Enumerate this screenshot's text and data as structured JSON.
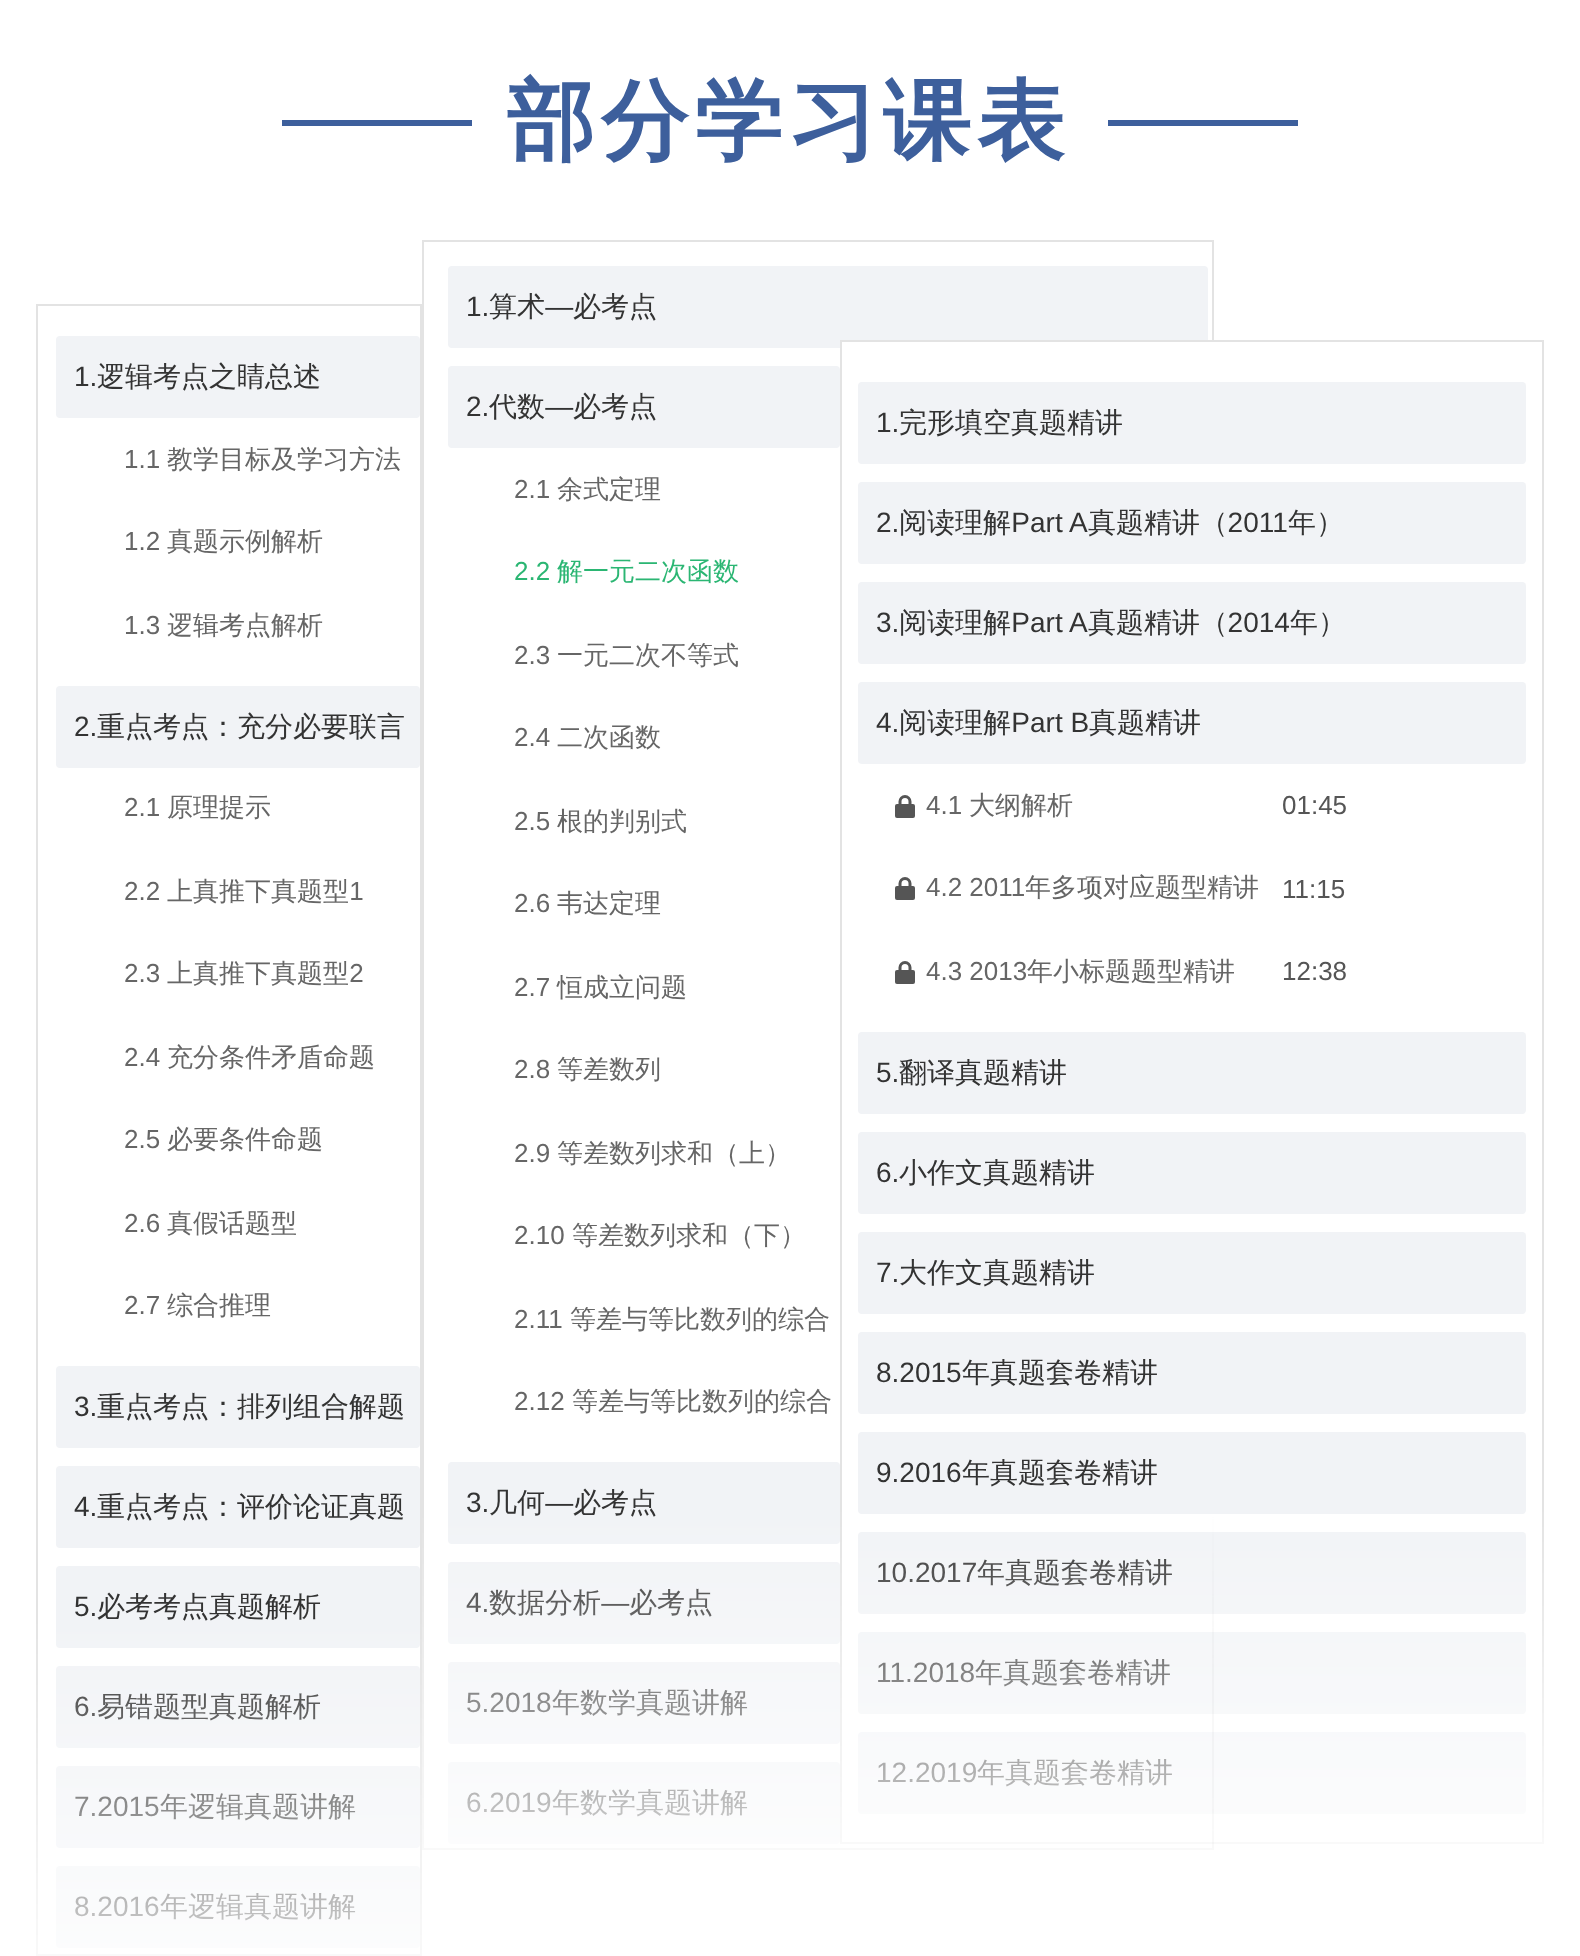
{
  "title": "部分学习课表",
  "cards": [
    {
      "sections": [
        {
          "title": "1.逻辑考点之睛总述",
          "lessons": [
            {
              "title": "1.1 教学目标及学习方法",
              "selected": false
            },
            {
              "title": "1.2 真题示例解析",
              "selected": false
            },
            {
              "title": "1.3 逻辑考点解析",
              "selected": false
            }
          ]
        },
        {
          "title": "2.重点考点：充分必要联言",
          "lessons": [
            {
              "title": "2.1 原理提示",
              "selected": false
            },
            {
              "title": "2.2 上真推下真题型1",
              "selected": false
            },
            {
              "title": "2.3 上真推下真题型2",
              "selected": false
            },
            {
              "title": "2.4 充分条件矛盾命题",
              "selected": false
            },
            {
              "title": "2.5 必要条件命题",
              "selected": false
            },
            {
              "title": "2.6 真假话题型",
              "selected": false
            },
            {
              "title": "2.7 综合推理",
              "selected": false
            }
          ]
        },
        {
          "title": "3.重点考点：排列组合解题"
        },
        {
          "title": "4.重点考点：评价论证真题"
        },
        {
          "title": "5.必考考点真题解析"
        },
        {
          "title": "6.易错题型真题解析"
        },
        {
          "title": "7.2015年逻辑真题讲解"
        },
        {
          "title": "8.2016年逻辑真题讲解"
        }
      ]
    },
    {
      "sections": [
        {
          "title": "1.算术—必考点"
        },
        {
          "title": "2.代数—必考点",
          "lessons": [
            {
              "title": "2.1 余式定理",
              "selected": false
            },
            {
              "title": "2.2 解一元二次函数",
              "selected": true
            },
            {
              "title": "2.3 一元二次不等式",
              "selected": false
            },
            {
              "title": "2.4 二次函数",
              "selected": false
            },
            {
              "title": "2.5 根的判别式",
              "selected": false
            },
            {
              "title": "2.6 韦达定理",
              "selected": false
            },
            {
              "title": "2.7 恒成立问题",
              "selected": false
            },
            {
              "title": "2.8 等差数列",
              "selected": false
            },
            {
              "title": "2.9 等差数列求和（上）",
              "selected": false
            },
            {
              "title": "2.10 等差数列求和（下）",
              "selected": false
            },
            {
              "title": "2.11 等差与等比数列的综合",
              "selected": false
            },
            {
              "title": "2.12 等差与等比数列的综合",
              "selected": false
            }
          ]
        },
        {
          "title": "3.几何—必考点"
        },
        {
          "title": "4.数据分析—必考点"
        },
        {
          "title": "5.2018年数学真题讲解"
        },
        {
          "title": "6.2019年数学真题讲解"
        }
      ]
    },
    {
      "sections": [
        {
          "title": "1.完形填空真题精讲"
        },
        {
          "title": "2.阅读理解Part A真题精讲（2011年）"
        },
        {
          "title": "3.阅读理解Part A真题精讲（2014年）"
        },
        {
          "title": "4.阅读理解Part B真题精讲",
          "lessons": [
            {
              "title": "4.1 大纲解析",
              "duration": "01:45",
              "locked": true,
              "selected": false
            },
            {
              "title": "4.2 2011年多项对应题型精讲",
              "duration": "11:15",
              "locked": true,
              "selected": false
            },
            {
              "title": "4.3 2013年小标题题型精讲",
              "duration": "12:38",
              "locked": true,
              "selected": false
            }
          ]
        },
        {
          "title": "5.翻译真题精讲"
        },
        {
          "title": "6.小作文真题精讲"
        },
        {
          "title": "7.大作文真题精讲"
        },
        {
          "title": "8.2015年真题套卷精讲"
        },
        {
          "title": "9.2016年真题套卷精讲"
        },
        {
          "title": "10.2017年真题套卷精讲"
        },
        {
          "title": "11.2018年真题套卷精讲"
        },
        {
          "title": "12.2019年真题套卷精讲"
        }
      ]
    }
  ]
}
